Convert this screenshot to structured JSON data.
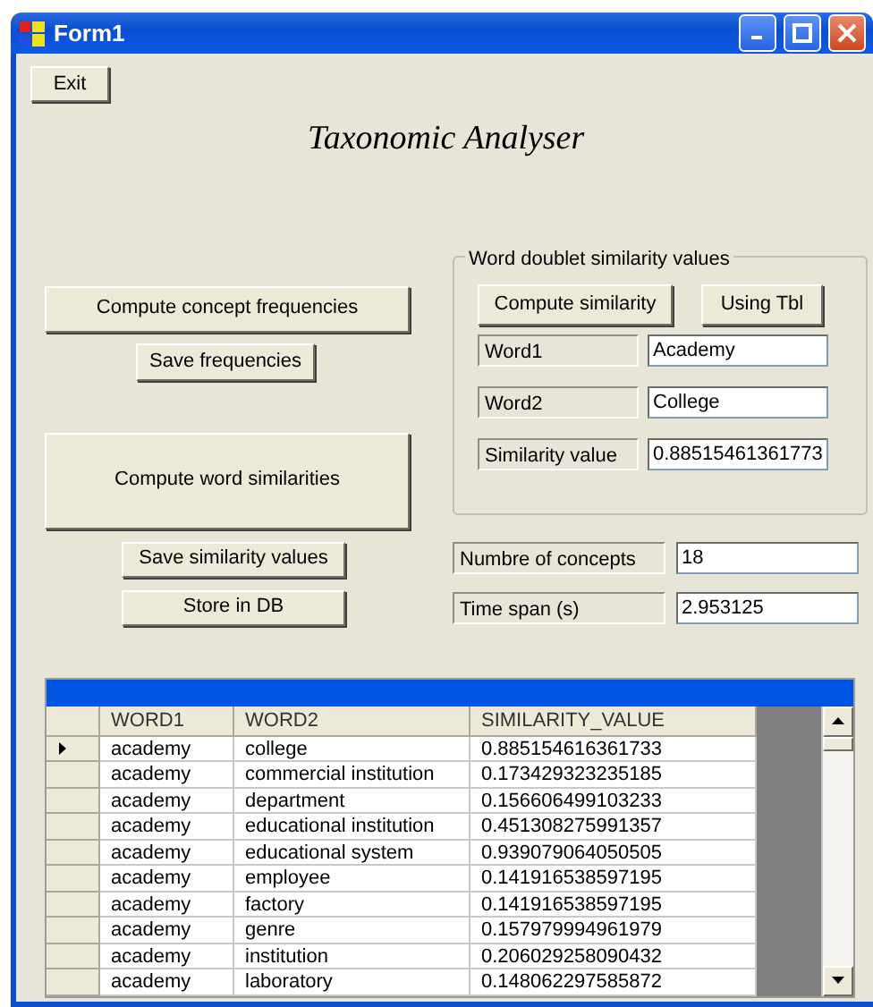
{
  "window": {
    "title": "Form1"
  },
  "exit_button": "Exit",
  "heading": "Taxonomic Analyser",
  "left_panel": {
    "compute_frequencies": "Compute concept frequencies",
    "save_frequencies": "Save frequencies",
    "compute_similarities": "Compute word similarities",
    "save_similarity_values": "Save similarity values",
    "store_in_db": "Store in DB"
  },
  "similarity_group": {
    "title": "Word doublet similarity values",
    "buttons": [
      "Compute similarity",
      "Using Tbl"
    ],
    "fields": [
      {
        "label": "Word1",
        "value": "Academy"
      },
      {
        "label": "Word2",
        "value": "College"
      },
      {
        "label": "Similarity value",
        "value": "0.88515461361773"
      }
    ]
  },
  "stats": [
    {
      "label": "Numbre of concepts",
      "value": "18"
    },
    {
      "label": "Time span (s)",
      "value": "2.953125"
    }
  ],
  "table": {
    "columns": [
      "WORD1",
      "WORD2",
      "SIMILARITY_VALUE"
    ],
    "rows": [
      {
        "cells": [
          "academy",
          "college",
          "0.885154616361733"
        ],
        "selected": true
      },
      {
        "cells": [
          "academy",
          "commercial institution",
          "0.173429323235185"
        ],
        "selected": false
      },
      {
        "cells": [
          "academy",
          "department",
          "0.156606499103233"
        ],
        "selected": false
      },
      {
        "cells": [
          "academy",
          "educational institution",
          "0.451308275991357"
        ],
        "selected": false
      },
      {
        "cells": [
          "academy",
          "educational system",
          "0.939079064050505"
        ],
        "selected": false
      },
      {
        "cells": [
          "academy",
          "employee",
          "0.141916538597195"
        ],
        "selected": false
      },
      {
        "cells": [
          "academy",
          "factory",
          "0.141916538597195"
        ],
        "selected": false
      },
      {
        "cells": [
          "academy",
          "genre",
          "0.157979994961979"
        ],
        "selected": false
      },
      {
        "cells": [
          "academy",
          "institution",
          "0.206029258090432"
        ],
        "selected": false
      },
      {
        "cells": [
          "academy",
          "laboratory",
          "0.148062297585872"
        ],
        "selected": false
      }
    ]
  }
}
